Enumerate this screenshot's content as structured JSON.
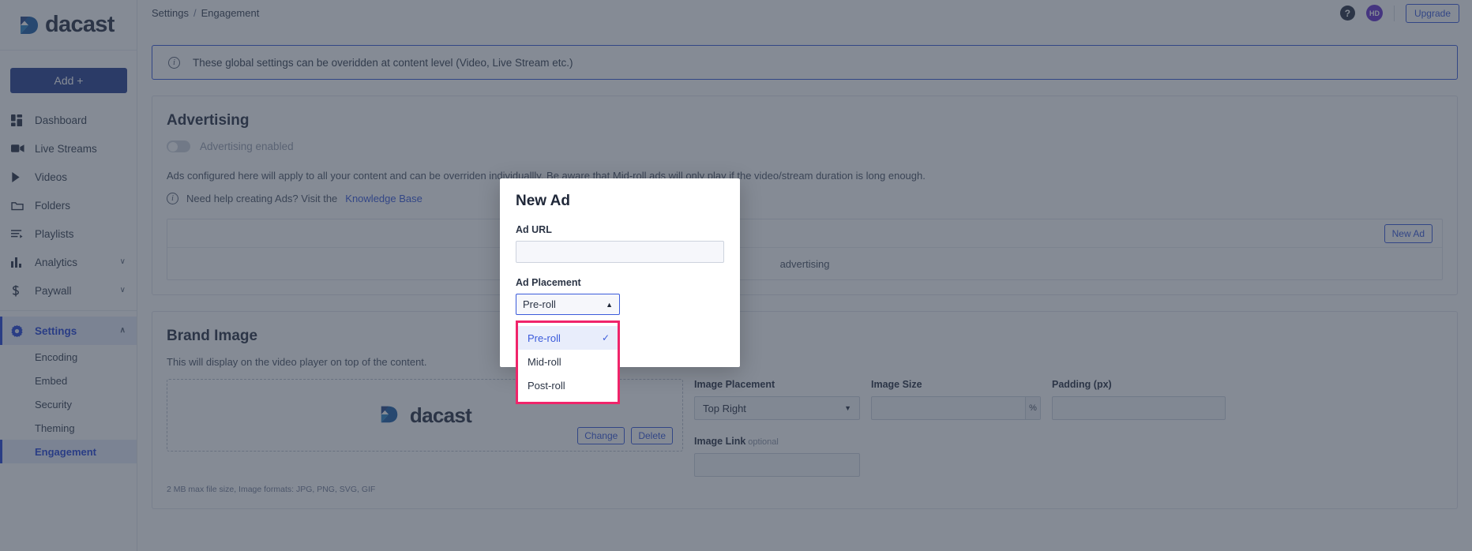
{
  "brand": {
    "name": "dacast"
  },
  "sidebar": {
    "add_button": "Add +",
    "items": [
      {
        "label": "Dashboard",
        "icon": "dashboard-icon",
        "chevron": ""
      },
      {
        "label": "Live Streams",
        "icon": "video-camera-icon",
        "chevron": ""
      },
      {
        "label": "Videos",
        "icon": "play-icon",
        "chevron": ""
      },
      {
        "label": "Folders",
        "icon": "folder-icon",
        "chevron": ""
      },
      {
        "label": "Playlists",
        "icon": "playlist-icon",
        "chevron": ""
      },
      {
        "label": "Analytics",
        "icon": "bar-chart-icon",
        "chevron": "∨"
      },
      {
        "label": "Paywall",
        "icon": "dollar-icon",
        "chevron": "∨"
      }
    ],
    "settings": {
      "label": "Settings",
      "icon": "gear-icon",
      "chevron": "∧"
    },
    "sub_items": [
      {
        "label": "Encoding"
      },
      {
        "label": "Embed"
      },
      {
        "label": "Security"
      },
      {
        "label": "Theming"
      },
      {
        "label": "Engagement"
      }
    ]
  },
  "topbar": {
    "breadcrumb_root": "Settings",
    "breadcrumb_sep": "/",
    "breadcrumb_current": "Engagement",
    "help_icon_glyph": "?",
    "avatar_initials": "HD",
    "upgrade_label": "Upgrade"
  },
  "banner": {
    "text": "These global settings can be overidden at content level (Video, Live Stream etc.)"
  },
  "advertising": {
    "title": "Advertising",
    "toggle_label": "Advertising enabled",
    "toggle_on": false,
    "description": "Ads configured here will apply to all your content and can be overriden individuallly. Be aware that Mid-roll ads will only play if the video/stream duration is long enough.",
    "help_prefix": "Need help creating Ads? Visit the",
    "help_link": "Knowledge Base",
    "new_ad_button": "New Ad",
    "empty_text": "advertising"
  },
  "brand_image": {
    "title": "Brand Image",
    "description": "This will display on the video player on top of the content.",
    "change_button": "Change",
    "delete_button": "Delete",
    "footnote": "2 MB max file size, Image formats: JPG, PNG, SVG, GIF",
    "placement_label": "Image Placement",
    "placement_value": "Top Right",
    "size_label": "Image Size",
    "size_value": "",
    "size_unit": "%",
    "padding_label": "Padding (px)",
    "padding_value": "",
    "link_label": "Image Link",
    "link_optional": "optional",
    "link_value": ""
  },
  "modal": {
    "title": "New Ad",
    "url_label": "Ad URL",
    "url_value": "",
    "url_placeholder": "",
    "placement_label": "Ad Placement",
    "placement_selected": "Pre-roll",
    "options": [
      {
        "label": "Pre-roll",
        "selected": true
      },
      {
        "label": "Mid-roll",
        "selected": false
      },
      {
        "label": "Post-roll",
        "selected": false
      }
    ],
    "check_glyph": "✓",
    "caret_up": "▲",
    "caret_down": "▼"
  },
  "colors": {
    "accent_blue": "#3b5bdb",
    "sidebar_active": "#2747d8",
    "highlight_pink": "#f0246a",
    "brand_dark": "#2b3445",
    "avatar_purple": "#6633cc"
  }
}
